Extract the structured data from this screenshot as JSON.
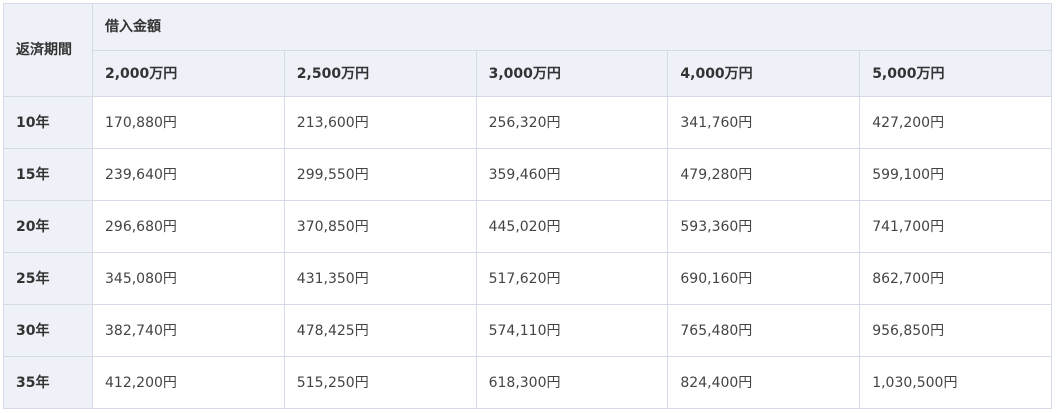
{
  "table": {
    "corner_label": "返済期間",
    "group_label": "借入金額",
    "columns": [
      "2,000万円",
      "2,500万円",
      "3,000万円",
      "4,000万円",
      "5,000万円"
    ],
    "rows": [
      {
        "term": "10年",
        "values": [
          "170,880円",
          "213,600円",
          "256,320円",
          "341,760円",
          "427,200円"
        ]
      },
      {
        "term": "15年",
        "values": [
          "239,640円",
          "299,550円",
          "359,460円",
          "479,280円",
          "599,100円"
        ]
      },
      {
        "term": "20年",
        "values": [
          "296,680円",
          "370,850円",
          "445,020円",
          "593,360円",
          "741,700円"
        ]
      },
      {
        "term": "25年",
        "values": [
          "345,080円",
          "431,350円",
          "517,620円",
          "690,160円",
          "862,700円"
        ]
      },
      {
        "term": "30年",
        "values": [
          "382,740円",
          "478,425円",
          "574,110円",
          "765,480円",
          "956,850円"
        ]
      },
      {
        "term": "35年",
        "values": [
          "412,200円",
          "515,250円",
          "618,300円",
          "824,400円",
          "1,030,500円"
        ]
      }
    ]
  }
}
